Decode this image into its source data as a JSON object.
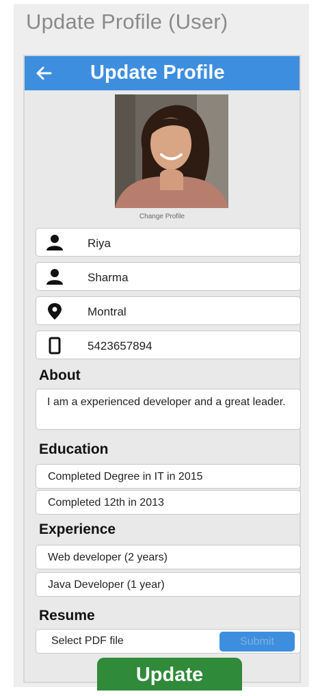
{
  "screen_title": "Update  Profile (User)",
  "appbar": {
    "title": "Update Profile",
    "back_icon": "arrow-left-icon"
  },
  "profile": {
    "change_label": "Change Profile"
  },
  "fields": [
    {
      "icon": "person-icon",
      "value": "Riya"
    },
    {
      "icon": "person-icon",
      "value": "Sharma"
    },
    {
      "icon": "location-pin-icon",
      "value": "Montral"
    },
    {
      "icon": "phone-icon",
      "value": "5423657894"
    }
  ],
  "about": {
    "label": "About",
    "text": "I am a experienced developer and a great leader."
  },
  "education": {
    "label": "Education",
    "items": [
      "Completed Degree in IT in 2015",
      "Completed 12th in 2013"
    ]
  },
  "experience": {
    "label": "Experience",
    "items": [
      "Web developer (2 years)",
      "Java Developer (1 year)"
    ]
  },
  "resume": {
    "label": "Resume",
    "placeholder": "Select PDF file",
    "submit_label": "Submit"
  },
  "update_label": "Update",
  "colors": {
    "accent": "#3d8ede",
    "update_button": "#2f8a39",
    "background": "#e9e9e9"
  }
}
